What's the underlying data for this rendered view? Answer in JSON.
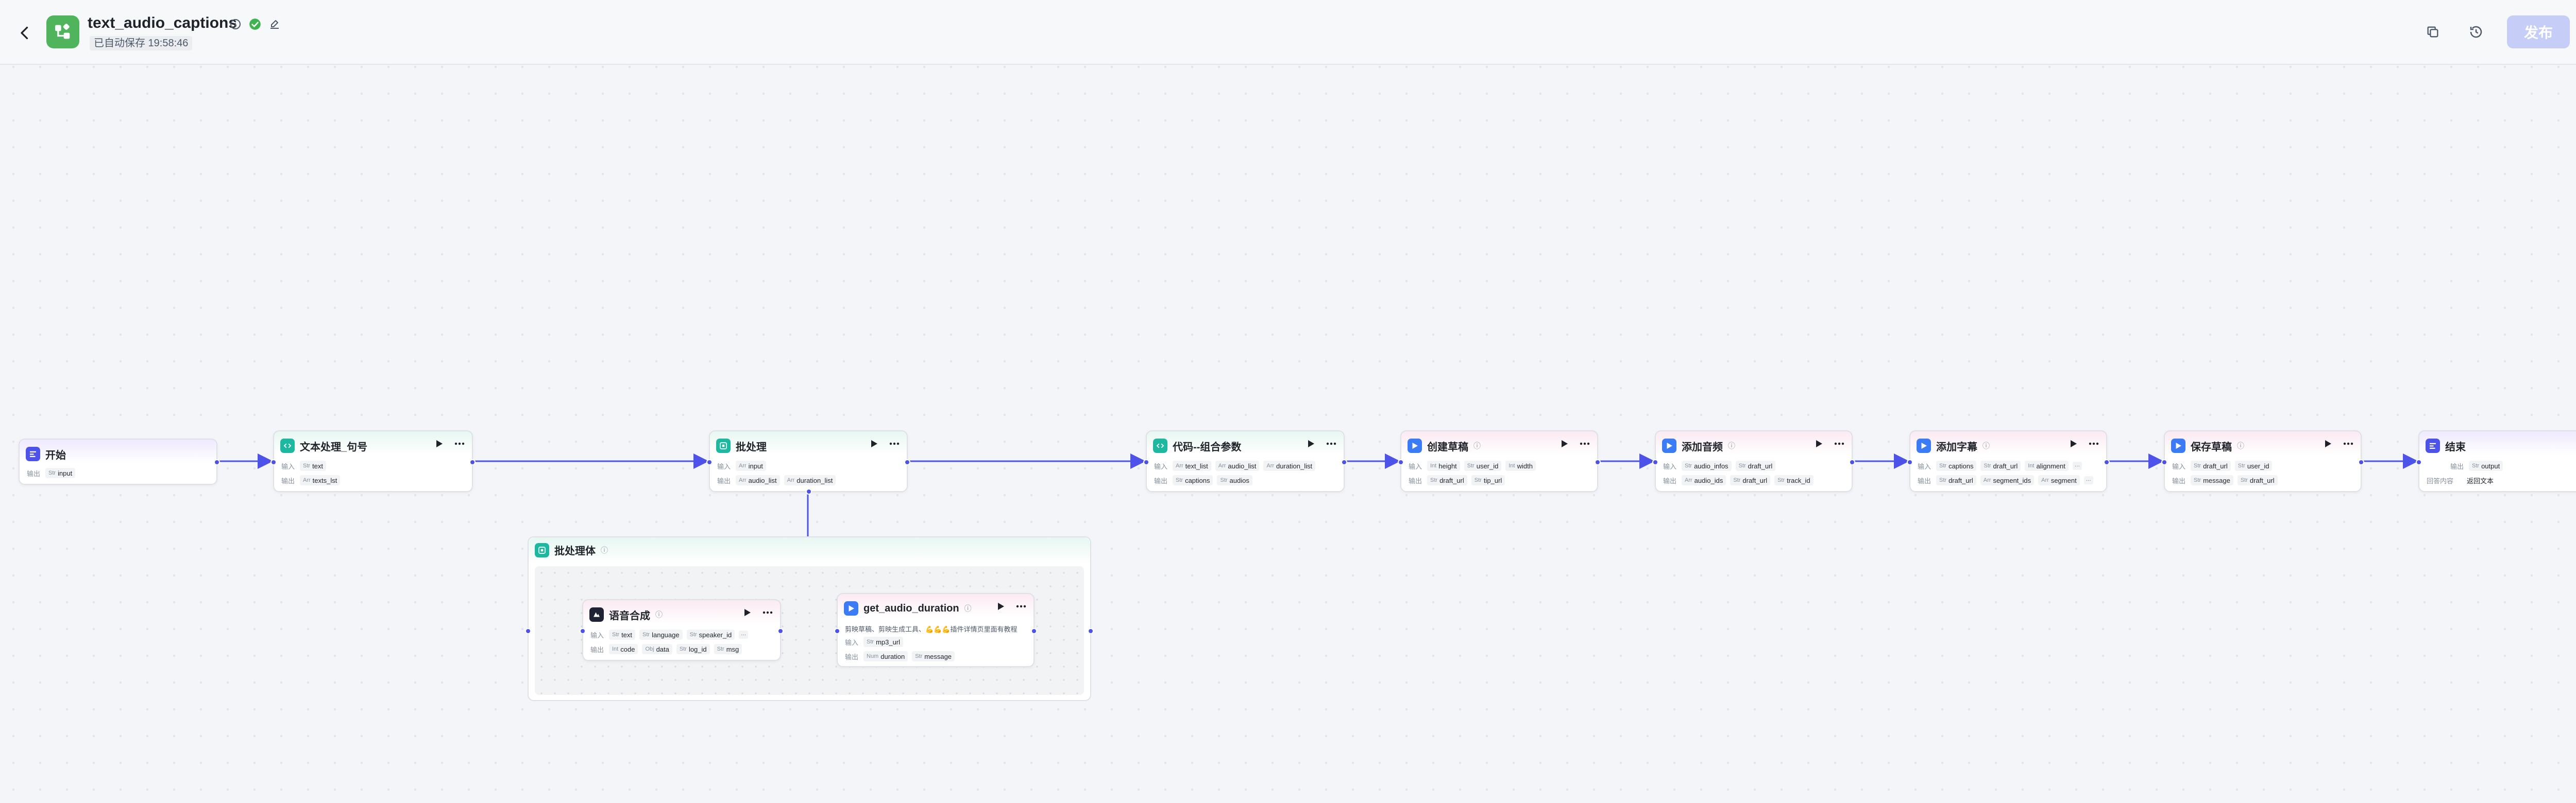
{
  "header": {
    "title": "text_audio_captions",
    "autosave": "已自动保存 19:58:46",
    "publish_label": "发布"
  },
  "colors": {
    "accent": "#4d53e8",
    "publish_disabled": "#c6cdf7",
    "code_node": "#1db8a0",
    "plugin_node": "#3b7cf6",
    "start_node": "#4d53e8",
    "tts_node": "#1f2233",
    "logo_green": "#4fb45c"
  },
  "nodes": {
    "start": {
      "title": "开始",
      "in_label": "输出",
      "params": [
        "input"
      ]
    },
    "text_proc": {
      "title": "文本处理_句号",
      "in_label": "输入",
      "out_label": "输出",
      "inputs": [
        "text"
      ],
      "outputs": [
        "texts_lst"
      ]
    },
    "batch": {
      "title": "批处理",
      "in_label": "输入",
      "out_label": "输出",
      "inputs": [
        "input"
      ],
      "outputs": [
        "audio_list",
        "duration_list"
      ]
    },
    "code_combine": {
      "title": "代码--组合参数",
      "in_label": "输入",
      "out_label": "输出",
      "inputs": [
        "text_list",
        "audio_list",
        "duration_list"
      ],
      "outputs": [
        "captions",
        "audios"
      ]
    },
    "create_draft": {
      "title": "创建草稿",
      "in_label": "输入",
      "out_label": "输出",
      "inputs": [
        "height",
        "user_id",
        "width"
      ],
      "outputs": [
        "draft_url",
        "tip_url"
      ]
    },
    "add_audio": {
      "title": "添加音频",
      "in_label": "输入",
      "out_label": "输出",
      "inputs": [
        "audio_infos",
        "draft_url"
      ],
      "outputs": [
        "audio_ids",
        "draft_url",
        "track_id"
      ]
    },
    "add_captions": {
      "title": "添加字幕",
      "in_label": "输入",
      "out_label": "输出",
      "inputs": [
        "captions",
        "draft_url",
        "alignment"
      ],
      "outputs": [
        "draft_url",
        "segment_ids",
        "segment"
      ]
    },
    "save_draft": {
      "title": "保存草稿",
      "in_label": "输入",
      "out_label": "输出",
      "inputs": [
        "draft_url",
        "user_id"
      ],
      "outputs": [
        "message",
        "draft_url"
      ]
    },
    "end": {
      "title": "结束",
      "out_label": "输出",
      "out_var": "output",
      "mode_label": "回答内容",
      "mode_value": "返回文本"
    },
    "batch_body": {
      "title": "批处理体"
    },
    "tts": {
      "title": "语音合成",
      "in_label": "输入",
      "out_label": "输出",
      "inputs": [
        "text",
        "language",
        "speaker_id"
      ],
      "outputs": [
        "code",
        "data",
        "log_id",
        "msg"
      ]
    },
    "get_duration": {
      "title": "get_audio_duration",
      "desc": "剪映草稿、剪映生成工具、💪💪💪插件详情页里面有教程",
      "in_label": "输入",
      "out_label": "输出",
      "inputs": [
        "mp3_url"
      ],
      "outputs": [
        "duration",
        "message"
      ]
    }
  }
}
